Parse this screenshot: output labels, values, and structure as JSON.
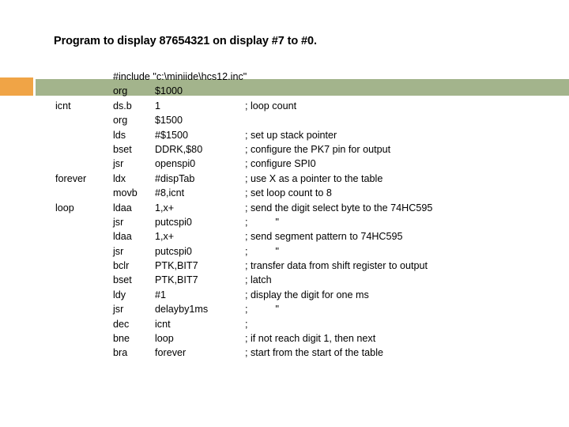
{
  "slide": {
    "title": "Program to display 87654321 on display #7 to #0.",
    "background_color": "#ffffff",
    "accent_orange": "#F0A446",
    "accent_green": "#A3B48C",
    "text_color": "#000000"
  },
  "code": {
    "lines": [
      {
        "label": "",
        "mnemonic": "",
        "operand": "",
        "comment": "",
        "full": "#include \"c:\\miniide\\hcs12.inc\""
      },
      {
        "label": "",
        "mnemonic": "org",
        "operand": "$1000",
        "comment": ""
      },
      {
        "label": "icnt",
        "mnemonic": "ds.b",
        "operand": "1",
        "comment": "; loop count"
      },
      {
        "label": "",
        "mnemonic": "org",
        "operand": "$1500",
        "comment": ""
      },
      {
        "label": "",
        "mnemonic": "lds",
        "operand": "#$1500",
        "comment": "; set up stack pointer"
      },
      {
        "label": "",
        "mnemonic": "bset",
        "operand": "DDRK,$80",
        "comment": "; configure the PK7 pin for output"
      },
      {
        "label": "",
        "mnemonic": "jsr",
        "operand": "openspi0",
        "comment": "; configure SPI0"
      },
      {
        "label": "forever",
        "mnemonic": "ldx",
        "operand": "#dispTab",
        "comment": "; use X as a pointer to the table"
      },
      {
        "label": "",
        "mnemonic": "movb",
        "operand": "#8,icnt",
        "comment": "; set loop count to 8"
      },
      {
        "label": "loop",
        "mnemonic": "ldaa",
        "operand": "1,x+",
        "comment": "; send the digit select byte to the 74HC595"
      },
      {
        "label": "",
        "mnemonic": "jsr",
        "operand": "putcspi0",
        "comment": ";          \""
      },
      {
        "label": "",
        "mnemonic": "ldaa",
        "operand": "1,x+",
        "comment": "; send segment pattern to 74HC595"
      },
      {
        "label": "",
        "mnemonic": "jsr",
        "operand": "putcspi0",
        "comment": ";          \""
      },
      {
        "label": "",
        "mnemonic": "bclr",
        "operand": "PTK,BIT7",
        "comment": "; transfer data from shift register to output"
      },
      {
        "label": "",
        "mnemonic": "bset",
        "operand": "PTK,BIT7",
        "comment": "; latch"
      },
      {
        "label": "",
        "mnemonic": "ldy",
        "operand": "#1",
        "comment": "; display the digit for one ms"
      },
      {
        "label": "",
        "mnemonic": "jsr",
        "operand": "delayby1ms",
        "comment": ";          \""
      },
      {
        "label": "",
        "mnemonic": "dec",
        "operand": "icnt",
        "comment": ";"
      },
      {
        "label": "",
        "mnemonic": "bne",
        "operand": "loop",
        "comment": "; if not reach digit 1, then next"
      },
      {
        "label": "",
        "mnemonic": "bra",
        "operand": "forever",
        "comment": "; start from the start of the table"
      }
    ]
  }
}
